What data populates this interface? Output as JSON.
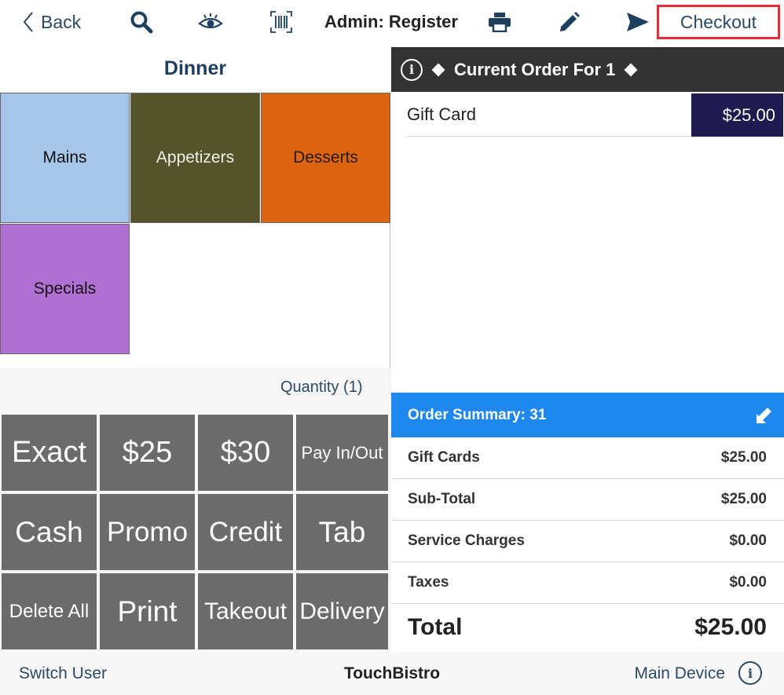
{
  "topbar": {
    "back_label": "Back",
    "icons": [
      "search-icon",
      "eye-icon",
      "barcode-icon",
      "printer-icon",
      "pencil-icon",
      "send-icon"
    ],
    "title": "Admin: Register",
    "checkout_label": "Checkout",
    "checkout_highlight_color": "#e0303a"
  },
  "menu": {
    "title": "Dinner",
    "categories": [
      {
        "label": "Mains",
        "color": "#a6c5e9"
      },
      {
        "label": "Appetizers",
        "color": "#54542c"
      },
      {
        "label": "Desserts",
        "color": "#dd6512"
      },
      {
        "label": "Specials",
        "color": "#b06fd3"
      }
    ]
  },
  "order": {
    "header": "Current Order For 1",
    "items": [
      {
        "name": "Gift Card",
        "price": "$25.00"
      }
    ]
  },
  "quantity_label": "Quantity (1)",
  "payment_buttons": [
    [
      "Exact",
      "$25",
      "$30",
      "Pay In/Out"
    ],
    [
      "Cash",
      "Promo",
      "Credit",
      "Tab"
    ],
    [
      "Delete All",
      "Print",
      "Takeout",
      "Delivery"
    ]
  ],
  "summary": {
    "header": "Order Summary: 31",
    "rows": [
      {
        "label": "Gift Cards",
        "value": "$25.00"
      },
      {
        "label": "Sub-Total",
        "value": "$25.00"
      },
      {
        "label": "Service Charges",
        "value": "$0.00"
      },
      {
        "label": "Taxes",
        "value": "$0.00"
      }
    ],
    "total_label": "Total",
    "total_value": "$25.00"
  },
  "footer": {
    "switch_user": "Switch User",
    "app_name": "TouchBistro",
    "device": "Main Device"
  }
}
